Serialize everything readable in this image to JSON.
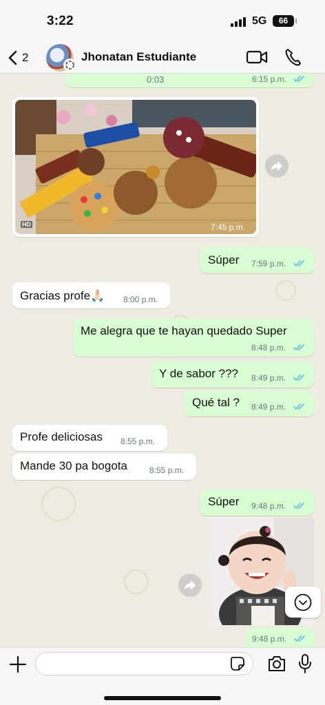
{
  "status_bar": {
    "time": "3:22",
    "network": "5G",
    "battery": "66"
  },
  "header": {
    "back_count": "2",
    "contact_name": "Jhonatan Estudiante"
  },
  "messages": [
    {
      "text": "0:03",
      "time": "6:15 p.m."
    },
    {
      "time": "7:45 p.m.",
      "badge": "HD"
    },
    {
      "text": "Súper",
      "time": "7:59 p.m."
    },
    {
      "text": "Gracias profe🙏🏻",
      "time": "8:00 p.m."
    },
    {
      "text": "Me alegra que te hayan quedado Super",
      "time": "8:48 p.m."
    },
    {
      "text": "Y de sabor ???",
      "time": "8:49 p.m."
    },
    {
      "text": "Qué tal ?",
      "time": "8:49 p.m."
    },
    {
      "text": "Profe deliciosas",
      "time": "8:55 p.m."
    },
    {
      "text": "Mande 30 pa bogota",
      "time": "8:55 p.m."
    },
    {
      "text": "Súper",
      "time": "9:48 p.m."
    },
    {
      "time": "9:48 p.m."
    }
  ],
  "input": {
    "placeholder": ""
  },
  "colors": {
    "outgoing_bubble": "#d9fdd3",
    "incoming_bubble": "#ffffff",
    "read_ticks": "#53bdeb",
    "wallpaper": "#efeae2"
  },
  "icons": [
    "chevron-left-icon",
    "status-ring-icon",
    "video-call-icon",
    "phone-icon",
    "forward-icon",
    "chevron-down-icon",
    "plus-icon",
    "sticker-icon",
    "camera-icon",
    "mic-icon",
    "double-check-icon"
  ]
}
